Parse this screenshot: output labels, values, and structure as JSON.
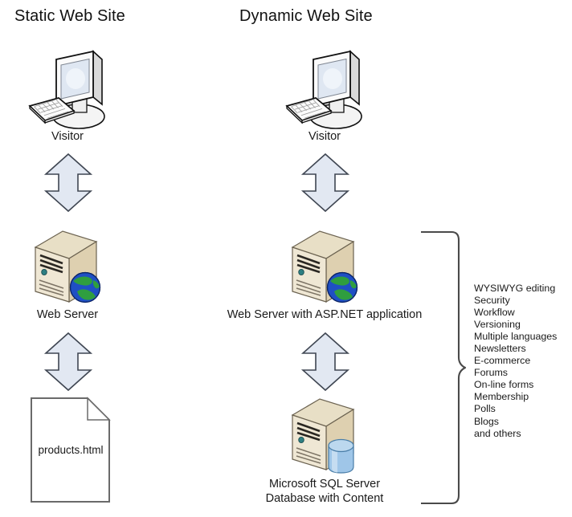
{
  "diagram": {
    "title_static": "Static Web Site",
    "title_dynamic": "Dynamic Web Site",
    "colors": {
      "arrow_fill": "#e2e8f2",
      "arrow_stroke": "#3f4652",
      "server_body": "#ded0b0",
      "server_front": "#efe7d4",
      "server_top": "#e8dfc6",
      "globe_blue": "#1f4fc4",
      "globe_green": "#2f9e3f",
      "db_blue": "#7fb3e0",
      "doc_stroke": "#6a6a6a",
      "monitor_screen": "#dfe7f2",
      "text": "#1a1a1a"
    },
    "static_column": {
      "visitor_label": "Visitor",
      "server_label": "Web Server",
      "document_label": "products.html",
      "icons": [
        "monitor-icon",
        "double-arrow-icon",
        "server-icon",
        "double-arrow-icon",
        "document-icon"
      ]
    },
    "dynamic_column": {
      "visitor_label": "Visitor",
      "server_label": "Web Server with ASP.NET application",
      "database_label_line1": "Microsoft SQL Server",
      "database_label_line2": "Database with Content",
      "icons": [
        "monitor-icon",
        "double-arrow-icon",
        "server-icon",
        "double-arrow-icon",
        "database-server-icon"
      ]
    },
    "features": {
      "bracket": "curly-brace",
      "items": [
        "WYSIWYG editing",
        "Security",
        "Workflow",
        "Versioning",
        "Multiple languages",
        "Newsletters",
        "E-commerce",
        "Forums",
        "On-line forms",
        "Membership",
        "Polls",
        "Blogs",
        "and others"
      ]
    }
  }
}
